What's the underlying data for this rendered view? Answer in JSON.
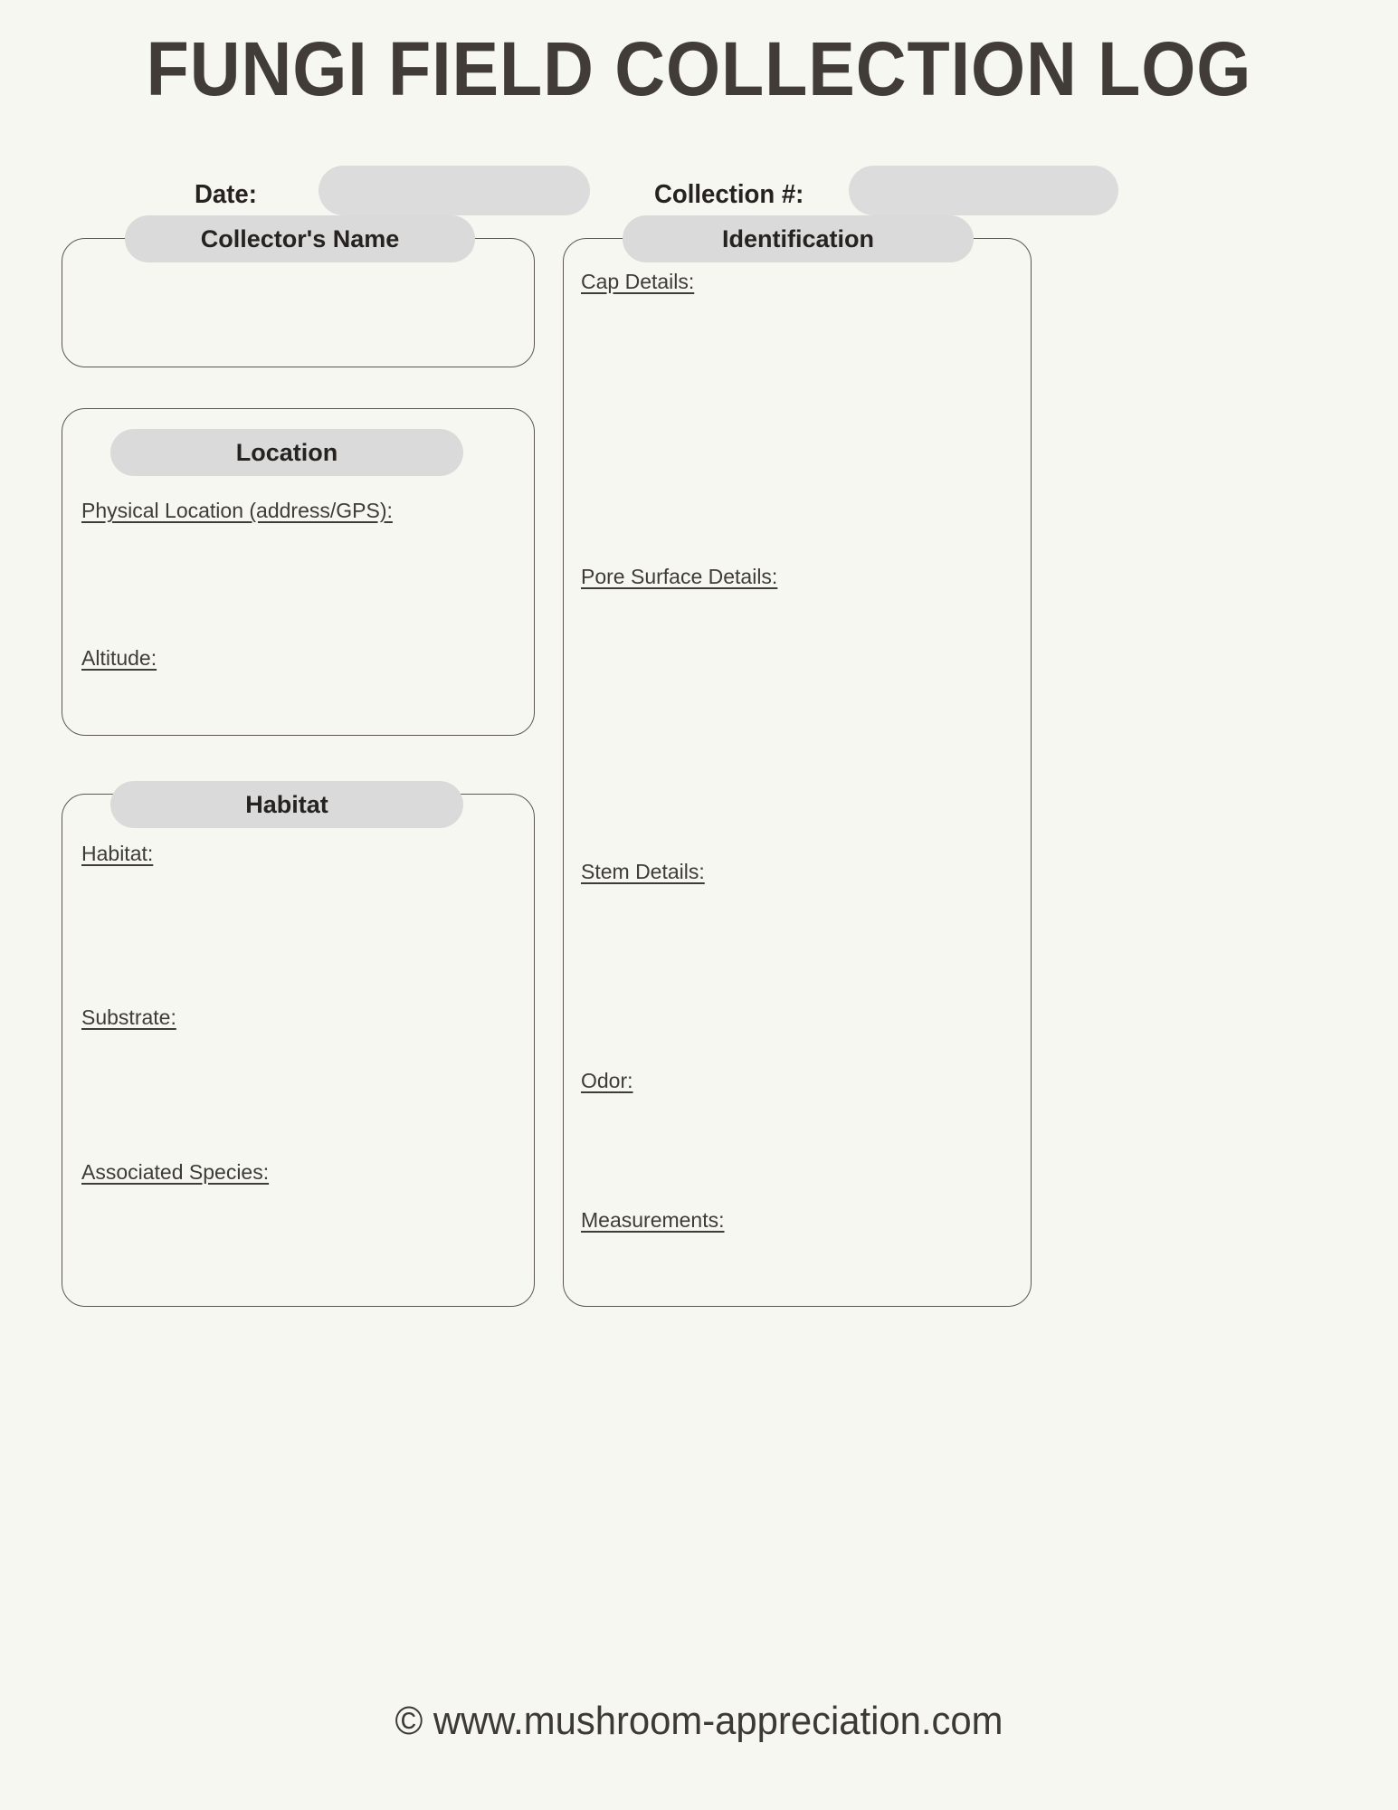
{
  "document": {
    "title": "FUNGI FIELD COLLECTION LOG",
    "footer": "© www.mushroom-appreciation.com"
  },
  "header_fields": {
    "date": {
      "label": "Date:",
      "value": "",
      "placeholder": ""
    },
    "collection_number": {
      "label": "Collection #:",
      "value": "",
      "placeholder": ""
    }
  },
  "sections": {
    "collector": {
      "header": "Collector's Name",
      "fields": []
    },
    "location": {
      "header": "Location",
      "fields": [
        {
          "label": "Physical Location (address/GPS):",
          "value": ""
        },
        {
          "label": "Altitude:",
          "value": ""
        }
      ]
    },
    "habitat": {
      "header": "Habitat",
      "fields": [
        {
          "label": "Habitat:",
          "value": ""
        },
        {
          "label": "Substrate:",
          "value": ""
        },
        {
          "label": "Associated Species:",
          "value": ""
        }
      ]
    },
    "identification": {
      "header": "Identification",
      "fields": [
        {
          "label": "Cap Details:",
          "value": ""
        },
        {
          "label": "Pore Surface Details:",
          "value": ""
        },
        {
          "label": "Stem Details:",
          "value": ""
        },
        {
          "label": "Odor:",
          "value": ""
        },
        {
          "label": "Measurements:",
          "value": ""
        }
      ]
    }
  },
  "colors": {
    "page_background": "#f7f7f2",
    "pill_fill": "#dadada",
    "input_fill": "#dcdcdc",
    "border": "#5c5753",
    "text": "#3d3935",
    "heading_text": "#26221f"
  }
}
